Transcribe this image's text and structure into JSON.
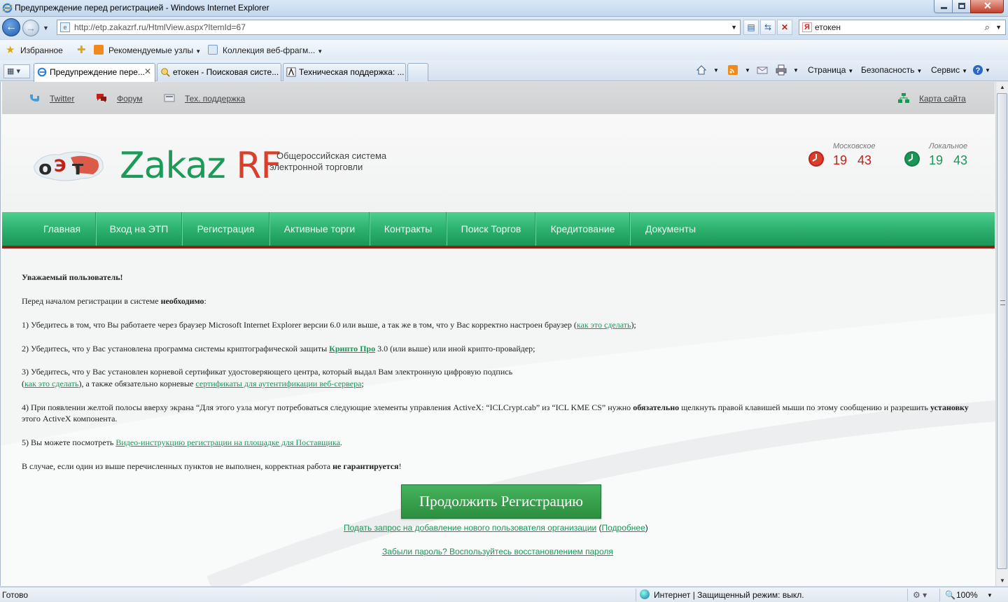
{
  "window": {
    "title": "Предупреждение перед регистрацией - Windows Internet Explorer"
  },
  "address": {
    "url": "http://etp.zakazrf.ru/HtmlView.aspx?ItemId=67"
  },
  "search": {
    "value": "етокен"
  },
  "favorites": {
    "label": "Избранное",
    "items": [
      "Рекомендуемые узлы",
      "Коллекция веб-фрагм..."
    ]
  },
  "tabs": [
    {
      "label": "Предупреждение пере..."
    },
    {
      "label": "етокен - Поисковая систе..."
    },
    {
      "label": "Техническая поддержка: ..."
    }
  ],
  "commands": {
    "page": "Страница",
    "safety": "Безопасность",
    "tools": "Сервис"
  },
  "site": {
    "top_links": [
      "Twitter",
      "Форум",
      "Тех. поддержка"
    ],
    "sitemap": "Карта сайта",
    "logo_text": "Zakaz",
    "logo_text_accent": "RF",
    "slogan_line1": "Общероссийская система",
    "slogan_line2": "электронной торговли",
    "clocks": [
      {
        "label": "Московское",
        "hours": "19",
        "minutes": "43",
        "color": "#c0211a"
      },
      {
        "label": "Локальное",
        "hours": "19",
        "minutes": "43",
        "color": "#1b9656"
      }
    ],
    "nav": [
      "Главная",
      "Вход на ЭТП",
      "Регистрация",
      "Активные торги",
      "Контракты",
      "Поиск Торгов",
      "Кредитование",
      "Документы"
    ]
  },
  "content": {
    "greeting": "Уважаемый пользователь!",
    "intro": "Перед началом регистрации в системе ",
    "intro_bold": "необходимо",
    "intro_end": ":",
    "item1": "1)    Убедитесь в том, что Вы работаете через браузер Microsoft Internet Explorer версии 6.0 или выше, а так же в том, что у Вас корректно настроен браузер (",
    "item1_link": "как это сделать",
    "item1_end": ");",
    "item2": "2)    Убедитесь, что у Вас установлена программа системы криптографической защиты ",
    "item2_link": "Крипто Про",
    "item2_end": " 3.0 (или выше) или иной крипто-провайдер;",
    "item3_line1": "3)    Убедитесь, что у Вас установлен корневой сертификат удостоверяющего центра, который выдал Вам электронную цифровую подпись",
    "item3_open": "(",
    "item3_link1": "как это сделать",
    "item3_mid": "), а также обязательно корневые ",
    "item3_link2": "сертификаты для аутентификации веб-сервера",
    "item3_end": ";",
    "item4_line1": "4)    При появлении желтой полосы вверху экрана “Для этого узла могут потребоваться следующие элементы управления ActiveX: “ICLCrypt.cab” из “ICL KME CS” нужно ",
    "item4_bold1": "обязательно",
    "item4_mid": " щелкнуть правой клавишей мыши по этому сообщению и разрешить ",
    "item4_bold2": "установку",
    "item4_line2": "этого ActiveX компонента.",
    "item5": "5)    Вы можете посмотреть ",
    "item5_link": "Видео-инструкцию регистрации на площадке для Поставщика",
    "item5_end": ".",
    "warning": "В случае, если один из выше перечисленных пунктов не выполнен, корректная работа ",
    "warning_bold": "не гарантируется",
    "warning_end": "!",
    "continue_button": "Продолжить Регистрацию",
    "request_link": "Подать запрос на добавление нового пользователя организации",
    "request_open": " (",
    "details_link": "Подробнее",
    "request_close": ")",
    "forgot_link": "Забыли пароль? Воспользуйтесь восстановлением пароля"
  },
  "status": {
    "left": "Готово",
    "zone": "Интернет | Защищенный режим: выкл.",
    "zoom": "100%"
  },
  "colors": {
    "brand_green": "#1b9656",
    "brand_red": "#d8402b",
    "nav_border": "#8a2218"
  }
}
